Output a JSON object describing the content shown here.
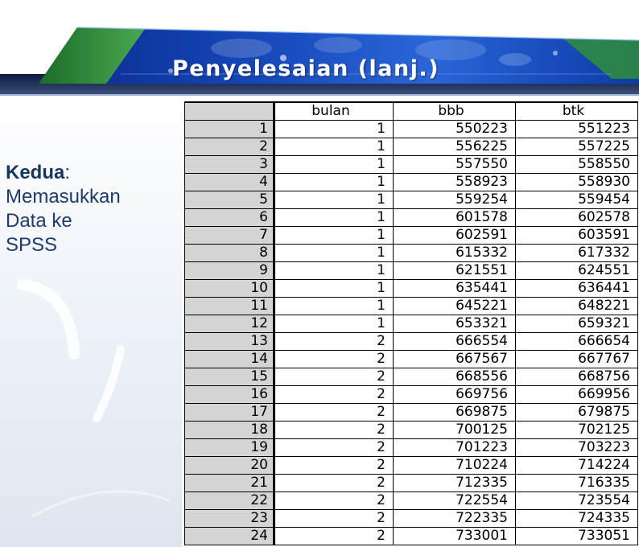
{
  "slide": {
    "title": "Penyelesaian (lanj.)"
  },
  "left_panel": {
    "lead": "Kedua",
    "colon": ":",
    "line1": "Memasukkan",
    "line2": "Data ke",
    "line3": "SPSS"
  },
  "grid": {
    "columns": [
      "bulan",
      "bbb",
      "btk"
    ],
    "rows": [
      {
        "n": "1",
        "bulan": "1",
        "bbb": "550223",
        "btk": "551223"
      },
      {
        "n": "2",
        "bulan": "1",
        "bbb": "556225",
        "btk": "557225"
      },
      {
        "n": "3",
        "bulan": "1",
        "bbb": "557550",
        "btk": "558550"
      },
      {
        "n": "4",
        "bulan": "1",
        "bbb": "558923",
        "btk": "558930"
      },
      {
        "n": "5",
        "bulan": "1",
        "bbb": "559254",
        "btk": "559454"
      },
      {
        "n": "6",
        "bulan": "1",
        "bbb": "601578",
        "btk": "602578"
      },
      {
        "n": "7",
        "bulan": "1",
        "bbb": "602591",
        "btk": "603591"
      },
      {
        "n": "8",
        "bulan": "1",
        "bbb": "615332",
        "btk": "617332"
      },
      {
        "n": "9",
        "bulan": "1",
        "bbb": "621551",
        "btk": "624551"
      },
      {
        "n": "10",
        "bulan": "1",
        "bbb": "635441",
        "btk": "636441"
      },
      {
        "n": "11",
        "bulan": "1",
        "bbb": "645221",
        "btk": "648221"
      },
      {
        "n": "12",
        "bulan": "1",
        "bbb": "653321",
        "btk": "659321"
      },
      {
        "n": "13",
        "bulan": "2",
        "bbb": "666554",
        "btk": "666654"
      },
      {
        "n": "14",
        "bulan": "2",
        "bbb": "667567",
        "btk": "667767"
      },
      {
        "n": "15",
        "bulan": "2",
        "bbb": "668556",
        "btk": "668756"
      },
      {
        "n": "16",
        "bulan": "2",
        "bbb": "669756",
        "btk": "669956"
      },
      {
        "n": "17",
        "bulan": "2",
        "bbb": "669875",
        "btk": "679875"
      },
      {
        "n": "18",
        "bulan": "2",
        "bbb": "700125",
        "btk": "702125"
      },
      {
        "n": "19",
        "bulan": "2",
        "bbb": "701223",
        "btk": "703223"
      },
      {
        "n": "20",
        "bulan": "2",
        "bbb": "710224",
        "btk": "714224"
      },
      {
        "n": "21",
        "bulan": "2",
        "bbb": "712335",
        "btk": "716335"
      },
      {
        "n": "22",
        "bulan": "2",
        "bbb": "722554",
        "btk": "723554"
      },
      {
        "n": "23",
        "bulan": "2",
        "bbb": "722335",
        "btk": "724335"
      },
      {
        "n": "24",
        "bulan": "2",
        "bbb": "733001",
        "btk": "733051"
      }
    ]
  },
  "colors": {
    "banner_dark": "#0a1f5c",
    "banner_light": "#2e6bd6",
    "banner_green": "#2f8f3a",
    "heading_text": "#17365d",
    "grid_header_bg": "#d4d4d4"
  }
}
